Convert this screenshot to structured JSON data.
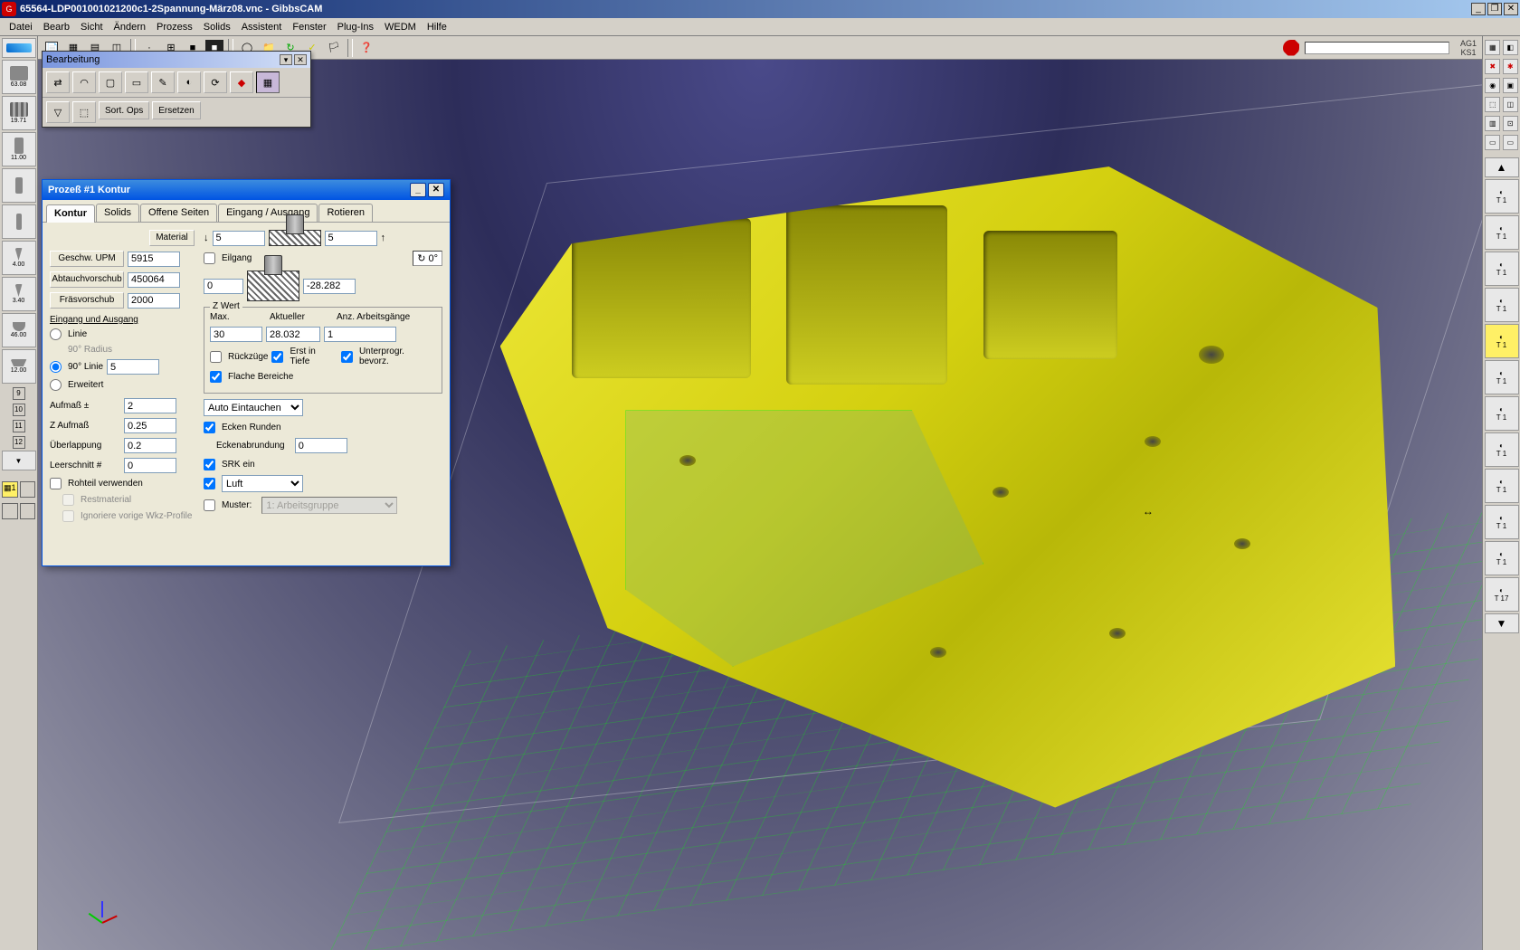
{
  "title": "65564-LDP001001021200c1-2Spannung-März08.vnc - GibbsCAM",
  "menu": [
    "Datei",
    "Bearb",
    "Sicht",
    "Ändern",
    "Prozess",
    "Solids",
    "Assistent",
    "Fenster",
    "Plug-Ins",
    "WEDM",
    "Hilfe"
  ],
  "topright": {
    "ag": "AG1",
    "ks": "KS1"
  },
  "leftTools": [
    {
      "dim": "63.08"
    },
    {
      "dim": "19.71"
    },
    {
      "dim": "11.00"
    },
    {
      "dim": ""
    },
    {
      "dim": ""
    },
    {
      "dim": "4.00"
    },
    {
      "dim": "3.40"
    },
    {
      "dim": "46.00"
    },
    {
      "dim": "12.00"
    }
  ],
  "leftNums": [
    "9",
    "10",
    "11",
    "12"
  ],
  "palette": {
    "title": "Bearbeitung",
    "sort": "Sort. Ops",
    "replace": "Ersetzen"
  },
  "rightTools": [
    "T 1",
    "T 1",
    "T 1",
    "T 1",
    "T 1",
    "T 1",
    "T 1",
    "T 1",
    "T 1",
    "T 1",
    "T 1",
    "T 17"
  ],
  "dialog": {
    "title": "Prozeß #1 Kontur",
    "tabs": [
      "Kontur",
      "Solids",
      "Offene Seiten",
      "Eingang / Ausgang",
      "Rotieren"
    ],
    "material": "Material",
    "speed_label": "Geschw. UPM",
    "speed": "5915",
    "plunge_label": "Abtauchvorschub",
    "plunge": "450064",
    "feed_label": "Fräsvorschub",
    "feed": "2000",
    "topZ": "5",
    "topZ2": "5",
    "eilgang": "Eilgang",
    "botZ": "0",
    "botZval": "-28.282",
    "angle": "0°",
    "eingang_title": "Eingang und Ausgang",
    "linie": "Linie",
    "radius90": "90° Radius",
    "linie90": "90° Linie",
    "linie90val": "5",
    "erweitert": "Erweitert",
    "aufmass": "Aufmaß ±",
    "aufmass_val": "2",
    "zaufmass": "Z Aufmaß",
    "zaufmass_val": "0.25",
    "ueberlappung": "Überlappung",
    "ueberlappung_val": "0.2",
    "leerschnitt": "Leerschnitt #",
    "leerschnitt_val": "0",
    "rohteil": "Rohteil verwenden",
    "restmaterial": "Restmaterial",
    "ignore": "Ignoriere vorige Wkz-Profile",
    "zwert": "Z Wert",
    "max": "Max.",
    "max_val": "30",
    "aktueller": "Aktueller",
    "aktueller_val": "28.032",
    "anz": "Anz. Arbeitsgänge",
    "anz_val": "1",
    "rueckzuege": "Rückzüge",
    "erst": "Erst in Tiefe",
    "unterprogr": "Unterprogr. bevorz.",
    "flache": "Flache Bereiche",
    "autoeintauchen": "Auto Eintauchen",
    "ecken": "Ecken Runden",
    "eckenabrund": "Eckenabrundung",
    "eckenabrund_val": "0",
    "srk": "SRK ein",
    "luft": "Luft",
    "muster": "Muster:",
    "muster_val": "1: Arbeitsgruppe"
  }
}
